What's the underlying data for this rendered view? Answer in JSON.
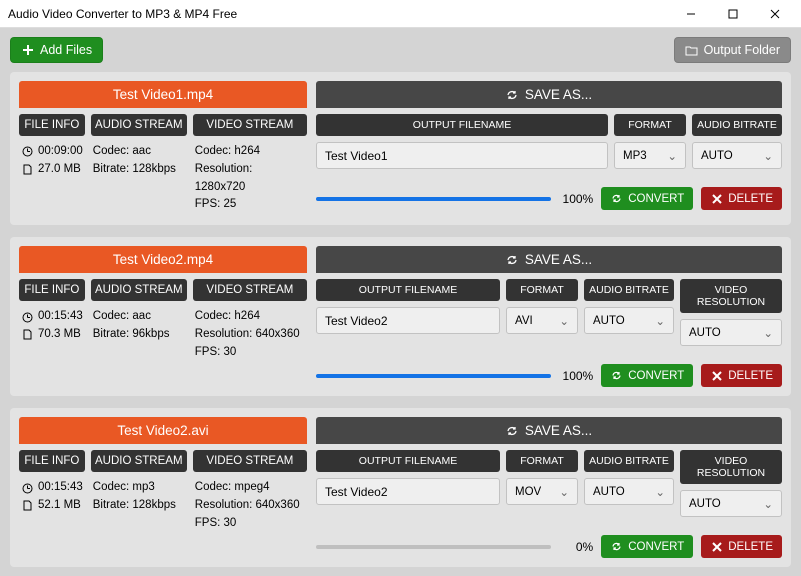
{
  "window": {
    "title": "Audio Video Converter to MP3 & MP4 Free"
  },
  "toolbar": {
    "add_label": "Add Files",
    "output_label": "Output Folder"
  },
  "labels": {
    "file_info": "FILE INFO",
    "audio_stream": "AUDIO STREAM",
    "video_stream": "VIDEO STREAM",
    "save_as": "SAVE AS...",
    "output_filename": "OUTPUT FILENAME",
    "format": "FORMAT",
    "audio_bitrate": "AUDIO BITRATE",
    "video_resolution": "VIDEO RESOLUTION",
    "convert": "CONVERT",
    "delete": "DELETE"
  },
  "items": [
    {
      "filename": "Test Video1.mp4",
      "duration": "00:09:00",
      "size": "27.0 MB",
      "audio_codec": "Codec: aac",
      "audio_bitrate": "Bitrate: 128kbps",
      "video_codec": "Codec: h264",
      "video_res": "Resolution: 1280x720",
      "video_fps": "FPS: 25",
      "out_name": "Test Video1",
      "format": "MP3",
      "abitrate": "AUTO",
      "vres": null,
      "progress": 100,
      "progress_label": "100%"
    },
    {
      "filename": "Test Video2.mp4",
      "duration": "00:15:43",
      "size": "70.3 MB",
      "audio_codec": "Codec: aac",
      "audio_bitrate": "Bitrate: 96kbps",
      "video_codec": "Codec: h264",
      "video_res": "Resolution: 640x360",
      "video_fps": "FPS: 30",
      "out_name": "Test Video2",
      "format": "AVI",
      "abitrate": "AUTO",
      "vres": "AUTO",
      "progress": 100,
      "progress_label": "100%"
    },
    {
      "filename": "Test Video2.avi",
      "duration": "00:15:43",
      "size": "52.1 MB",
      "audio_codec": "Codec: mp3",
      "audio_bitrate": "Bitrate: 128kbps",
      "video_codec": "Codec: mpeg4",
      "video_res": "Resolution: 640x360",
      "video_fps": "FPS: 30",
      "out_name": "Test Video2",
      "format": "MOV",
      "abitrate": "AUTO",
      "vres": "AUTO",
      "progress": 0,
      "progress_label": "0%"
    }
  ]
}
